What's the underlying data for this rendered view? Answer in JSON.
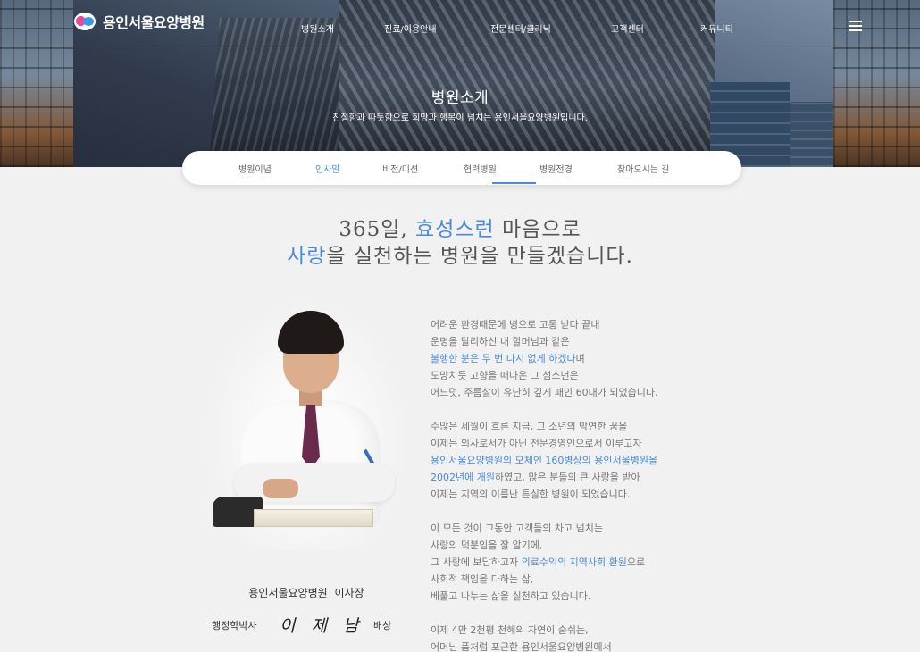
{
  "header": {
    "logo_text": "용인서울요양병원",
    "nav": [
      "병원소개",
      "진료/이용안내",
      "전문센터/클리닉",
      "고객센터",
      "커뮤니티"
    ]
  },
  "hero": {
    "title": "병원소개",
    "subtitle": "친절함과 따뜻함으로 희망과 행복이 넘치는 용인서울요양병원입니다."
  },
  "subnav": {
    "items": [
      "병원이념",
      "인사말",
      "비전/미션",
      "협력병원",
      "병원전경",
      "찾아오시는 길"
    ],
    "active": "인사말"
  },
  "headline": {
    "l1a": "365일, ",
    "l1b": "효성스런",
    "l1c": " 마음으로",
    "l2a": "사랑",
    "l2b": "을 실천하는 병원을 만들겠습니다."
  },
  "ceo": {
    "title": "용인서울요양병원 이사장",
    "degree": "행정학박사",
    "name": "이 제 남",
    "bow": "배상"
  },
  "message": {
    "p1": "어려운 환경때문에 병으로 고통 받다 끝내",
    "p2": "운명을 달리하신 내 할머님과 같은",
    "p3a": "불행한 분은 두 번 다시 없게 하겠다",
    "p3b": "며",
    "p4": "도망치듯 고향을 떠나온 그 섬소년은",
    "p5": "어느덧, 주름살이 유난히 깊게 패인 60대가 되었습니다.",
    "p6": "수많은 세월이 흐른 지금, 그 소년의 막연한 꿈을",
    "p7": "이제는 의사로서가 아닌 전문경영인으로서 이루고자",
    "p8a": "용인서울요양병원의 모체인 160병상의 용인서울병원을",
    "p9a": "2002년에 개원",
    "p9b": "하였고, 많은 분들의 큰 사랑을 받아",
    "p10": "이제는 지역의 이름난 튼실한 병원이 되었습니다.",
    "p11": "이 모든 것이 그동안 고객들의 차고 넘치는",
    "p12": "사랑의 덕분임을 잘 알기에,",
    "p13a": "그 사랑에 보답하고자 ",
    "p13b": "의료수익의 지역사회 환원",
    "p13c": "으로",
    "p14": "사회적 책임을 다하는 삶,",
    "p15": "베풀고 나누는 삶을 실천하고 있습니다.",
    "p16": "이제 4만 2천평 천혜의 자연이 숨쉬는,",
    "p17": "어머님 품처럼 포근한 용인서울요양병원에서"
  },
  "colors": {
    "accent": "#4a8ad8",
    "background": "#f1f1f1",
    "text": "#777777"
  }
}
